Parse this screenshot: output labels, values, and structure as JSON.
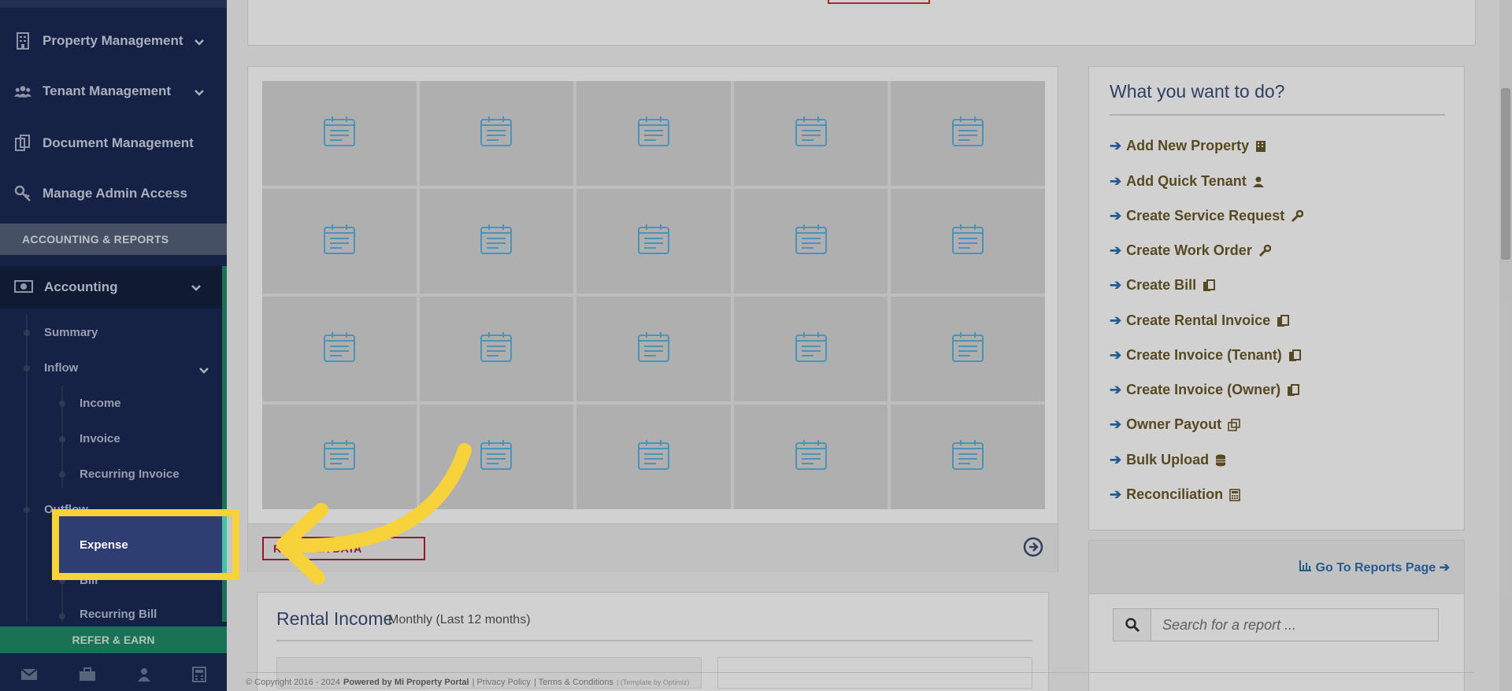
{
  "sidebar": {
    "items": [
      {
        "label": "Property Management",
        "icon": "building-icon"
      },
      {
        "label": "Tenant Management",
        "icon": "users-icon"
      },
      {
        "label": "Document Management",
        "icon": "documents-icon"
      },
      {
        "label": "Manage Admin Access",
        "icon": "key-icon"
      }
    ],
    "section_label": "ACCOUNTING & REPORTS",
    "accounting_label": "Accounting",
    "summary_label": "Summary",
    "inflow_label": "Inflow",
    "inflow_items": [
      "Income",
      "Invoice",
      "Recurring Invoice"
    ],
    "outflow_label": "Outflow",
    "expense_label": "Expense",
    "bill_label": "Bill",
    "recurring_bill_label": "Recurring Bill",
    "refer_label": "REFER & EARN"
  },
  "grid": {
    "register_label": "REGISTER DATA"
  },
  "actions": {
    "title": "What you want to do?",
    "items": [
      "Add New Property",
      "Add Quick Tenant",
      "Create Service Request",
      "Create Work Order",
      "Create Bill",
      "Create Rental Invoice",
      "Create Invoice (Tenant)",
      "Create Invoice (Owner)",
      "Owner Payout",
      "Bulk Upload",
      "Reconciliation"
    ]
  },
  "reports": {
    "link_label": "Go To Reports Page",
    "search_placeholder": "Search for a report ..."
  },
  "rental": {
    "title": "Rental Income",
    "subtitle": "Monthly (Last 12 months)"
  },
  "footer": {
    "copyright": "© Copyright 2016 - 2024",
    "powered": "Powered by Mi Property Portal",
    "privacy": "| Privacy Policy",
    "terms": "| Terms & Conditions",
    "template": "| (Template by Optimiz)"
  },
  "colors": {
    "sidebar_bg": "#1b2a55",
    "accent_green": "#1f8a6a",
    "highlight_yellow": "#f7d23b",
    "link_blue": "#2f6fb3"
  }
}
